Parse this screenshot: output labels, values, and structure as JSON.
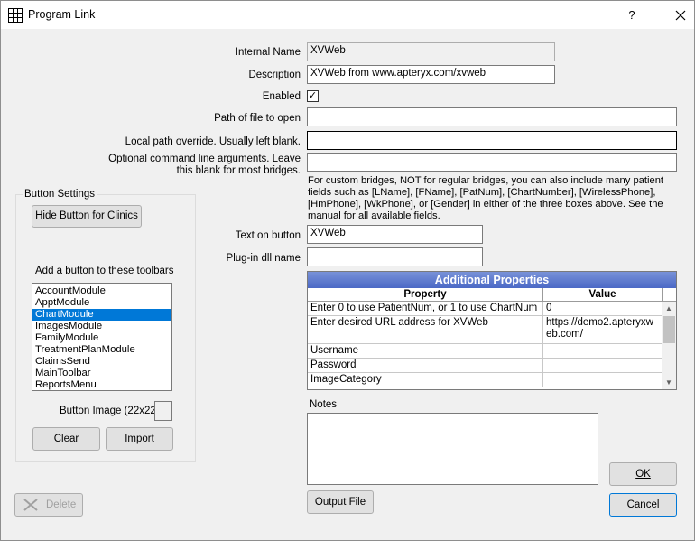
{
  "window": {
    "title": "Program Link",
    "help_label": "?",
    "close_label": "✕"
  },
  "form": {
    "internal_name": {
      "label": "Internal Name",
      "value": "XVWeb"
    },
    "description": {
      "label": "Description",
      "value": "XVWeb from www.apteryx.com/xvweb"
    },
    "enabled": {
      "label": "Enabled",
      "checked": true,
      "mark": "✓"
    },
    "path": {
      "label": "Path of file to open",
      "value": ""
    },
    "local_path": {
      "label": "Local path override.  Usually left blank.",
      "value": ""
    },
    "command_line": {
      "label": "Optional command line arguments.  Leave this blank for most bridges.",
      "value": ""
    },
    "info_text": "For custom bridges, NOT for regular bridges, you can also include many patient fields such as [LName], [FName], [PatNum], [ChartNumber], [WirelessPhone], [HmPhone], [WkPhone], or [Gender] in either of the three boxes above. See the manual for all available fields.",
    "text_on_button": {
      "label": "Text on button",
      "value": "XVWeb"
    },
    "plugin_dll": {
      "label": "Plug-in dll name",
      "value": ""
    }
  },
  "button_settings": {
    "group_title": "Button Settings",
    "hide_button_label": "Hide Button for Clinics",
    "toolbars_label": "Add a button to these toolbars",
    "toolbars": [
      "AccountModule",
      "ApptModule",
      "ChartModule",
      "ImagesModule",
      "FamilyModule",
      "TreatmentPlanModule",
      "ClaimsSend",
      "MainToolbar",
      "ReportsMenu"
    ],
    "selected_toolbar": "ChartModule",
    "button_image_label": "Button Image (22x22)",
    "clear_label": "Clear",
    "import_label": "Import"
  },
  "properties": {
    "title": "Additional Properties",
    "columns": [
      "Property",
      "Value"
    ],
    "rows": [
      {
        "property": "Enter 0 to use PatientNum, or 1 to use ChartNum",
        "value": "0"
      },
      {
        "property": "Enter desired URL address for XVWeb",
        "value": "https://demo2.apteryxweb.com/"
      },
      {
        "property": "Username",
        "value": ""
      },
      {
        "property": "Password",
        "value": ""
      },
      {
        "property": "ImageCategory",
        "value": ""
      }
    ]
  },
  "notes_label": "Notes",
  "buttons": {
    "delete_label": "Delete",
    "output_file_label": "Output File",
    "ok_label": "OK",
    "cancel_label": "Cancel"
  }
}
